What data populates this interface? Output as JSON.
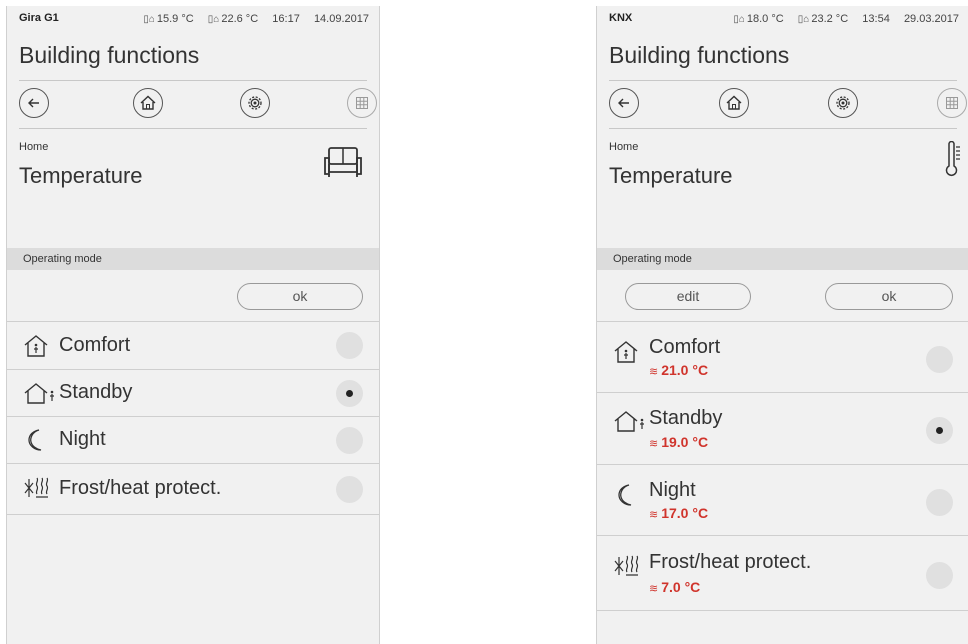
{
  "left": {
    "device": "Gira G1",
    "outside_temp": "15.9 °C",
    "inside_temp": "22.6 °C",
    "time": "16:17",
    "date": "14.09.2017",
    "title": "Building functions",
    "breadcrumb": "Home",
    "page_title": "Temperature",
    "section": "Operating mode",
    "ok_label": "ok",
    "modes": [
      {
        "label": "Comfort",
        "selected": false
      },
      {
        "label": "Standby",
        "selected": true
      },
      {
        "label": "Night",
        "selected": false
      },
      {
        "label": "Frost/heat protect.",
        "selected": false
      }
    ]
  },
  "right": {
    "device": "KNX",
    "outside_temp": "18.0 °C",
    "inside_temp": "23.2 °C",
    "time": "13:54",
    "date": "29.03.2017",
    "title": "Building functions",
    "breadcrumb": "Home",
    "page_title": "Temperature",
    "section": "Operating mode",
    "edit_label": "edit",
    "ok_label": "ok",
    "modes": [
      {
        "label": "Comfort",
        "temp": "21.0 °C",
        "selected": false
      },
      {
        "label": "Standby",
        "temp": "19.0 °C",
        "selected": true
      },
      {
        "label": "Night",
        "temp": "17.0 °C",
        "selected": false
      },
      {
        "label": "Frost/heat protect.",
        "temp": "7.0 °C",
        "selected": false
      }
    ]
  },
  "icons": {
    "nav": [
      "back-arrow-icon",
      "home-icon",
      "settings-gear-icon",
      "grid-view-icon"
    ],
    "left_room": "sofa-icon",
    "right_room": "thermometer-icon",
    "modes": [
      "comfort-house-icon",
      "standby-house-person-icon",
      "night-moon-icon",
      "frost-heat-icon"
    ]
  },
  "colors": {
    "accent_red": "#d0342c",
    "panel_bg": "#f1f1f1",
    "section_bg": "#dcdcdc"
  }
}
